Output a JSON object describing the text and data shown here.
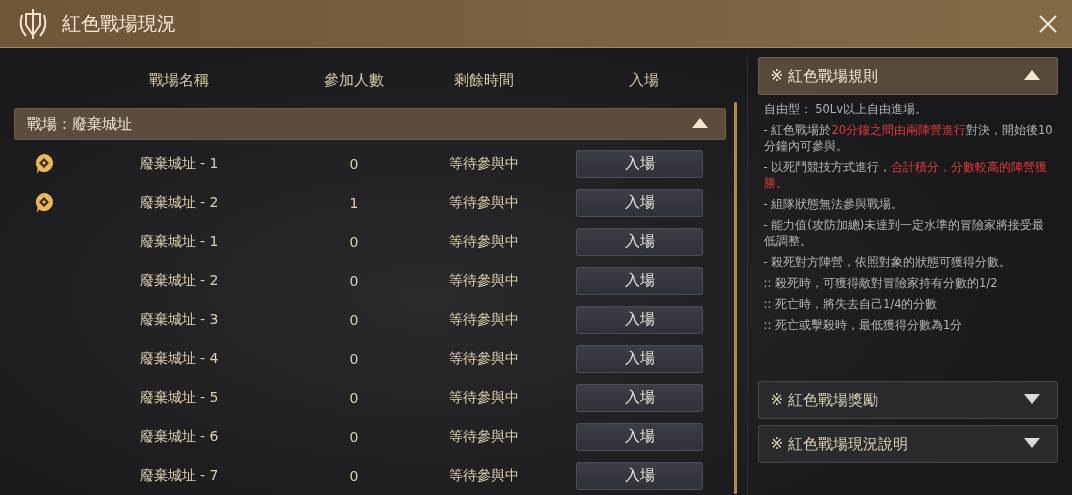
{
  "window": {
    "title": "紅色戰場現況"
  },
  "table": {
    "columns": [
      "戰場名稱",
      "參加人數",
      "剩餘時間",
      "入場"
    ],
    "group": {
      "label": "戰場：廢棄城址",
      "expanded": true
    },
    "rows": [
      {
        "marked": true,
        "name": "廢棄城址 - 1",
        "count": "0",
        "status": "等待參與中",
        "button": "入場"
      },
      {
        "marked": true,
        "name": "廢棄城址 - 2",
        "count": "1",
        "status": "等待參與中",
        "button": "入場"
      },
      {
        "marked": false,
        "name": "廢棄城址 - 1",
        "count": "0",
        "status": "等待參與中",
        "button": "入場"
      },
      {
        "marked": false,
        "name": "廢棄城址 - 2",
        "count": "0",
        "status": "等待參與中",
        "button": "入場"
      },
      {
        "marked": false,
        "name": "廢棄城址 - 3",
        "count": "0",
        "status": "等待參與中",
        "button": "入場"
      },
      {
        "marked": false,
        "name": "廢棄城址 - 4",
        "count": "0",
        "status": "等待參與中",
        "button": "入場"
      },
      {
        "marked": false,
        "name": "廢棄城址 - 5",
        "count": "0",
        "status": "等待參與中",
        "button": "入場"
      },
      {
        "marked": false,
        "name": "廢棄城址 - 6",
        "count": "0",
        "status": "等待參與中",
        "button": "入場"
      },
      {
        "marked": false,
        "name": "廢棄城址 - 7",
        "count": "0",
        "status": "等待參與中",
        "button": "入場"
      }
    ]
  },
  "sections": [
    {
      "title": "※ 紅色戰場規則",
      "expanded": true,
      "lines": [
        [
          {
            "text": "自由型： 50Lv以上自由進場。",
            "highlight": false
          }
        ],
        [
          {
            "text": "- 紅色戰場於",
            "highlight": false
          },
          {
            "text": "20分鐘之間由兩陣營進行",
            "highlight": true
          },
          {
            "text": "對決，開始後10分鐘內可參與。",
            "highlight": false
          }
        ],
        [
          {
            "text": "- 以死鬥競技方式進行，",
            "highlight": false
          },
          {
            "text": "合計積分，分數較高的陣營獲勝。",
            "highlight": true
          }
        ],
        [
          {
            "text": "- 組隊狀態無法參與戰場。",
            "highlight": false
          }
        ],
        [
          {
            "text": "- 能力值(攻防加總)未達到一定水準的冒險家將接受最低調整。",
            "highlight": false
          }
        ],
        [
          {
            "text": "- 殺死對方陣營，依照對象的狀態可獲得分數。",
            "highlight": false
          }
        ],
        [
          {
            "text": ":: 殺死時，可獲得敵對冒險家持有分數的1/2",
            "highlight": false
          }
        ],
        [
          {
            "text": ":: 死亡時，將失去自己1/4的分數",
            "highlight": false
          }
        ],
        [
          {
            "text": ":: 死亡或擊殺時，最低獲得分數為1分",
            "highlight": false
          }
        ]
      ]
    },
    {
      "title": "※ 紅色戰場獎勵",
      "expanded": false
    },
    {
      "title": "※ 紅色戰場現況說明",
      "expanded": false
    }
  ]
}
